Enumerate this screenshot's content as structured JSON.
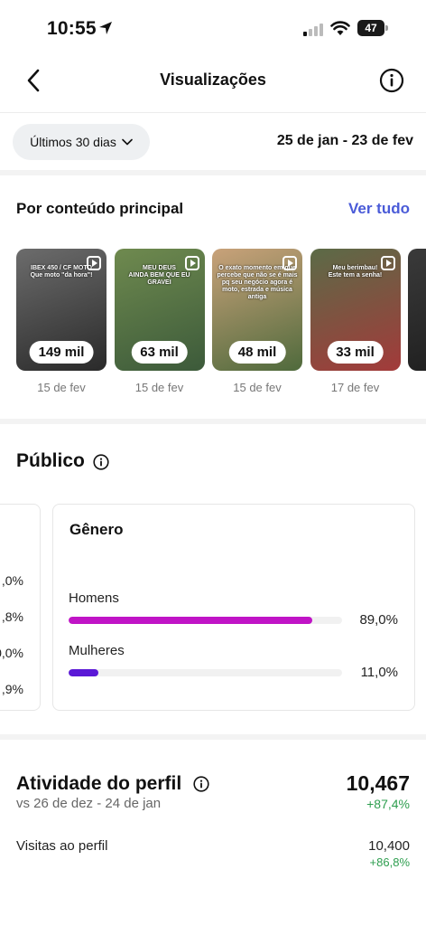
{
  "status_bar": {
    "time": "10:55",
    "battery": "47"
  },
  "header": {
    "title": "Visualizações",
    "back_icon": "chevron-left-icon",
    "info_icon": "info-icon"
  },
  "filter": {
    "period_label": "Últimos 30 dias",
    "date_range": "25 de jan - 23 de fev"
  },
  "top_content": {
    "title": "Por conteúdo principal",
    "see_all": "Ver tudo",
    "items": [
      {
        "caption": "IBEX 450 / CF MOTO\nQue moto \"da hora\"!",
        "views": "149 mil",
        "date": "15 de fev",
        "colors": [
          "#6c6c6c",
          "#2a2a2a"
        ]
      },
      {
        "caption": "MEU DEUS\nAINDA BEM QUE EU GRAVEI",
        "views": "63 mil",
        "date": "15 de fev",
        "colors": [
          "#6f8a4f",
          "#3c5a3a"
        ]
      },
      {
        "caption": "O exato momento em que percebe que não se é mais pq seu negócio agora é moto, estrada e música antiga",
        "views": "48 mil",
        "date": "15 de fev",
        "colors": [
          "#c9a27a",
          "#4f6a3c"
        ]
      },
      {
        "caption": "Meu berimbau!\nEste tem a senha!",
        "views": "33 mil",
        "date": "17 de fev",
        "colors": [
          "#5b6b47",
          "#a33a3a"
        ]
      }
    ]
  },
  "audience": {
    "title": "Público",
    "left_card_values": [
      ",0%",
      ",8%",
      "0,0%",
      ",9%"
    ],
    "gender": {
      "title": "Gênero",
      "rows": [
        {
          "label": "Homens",
          "percent_label": "89,0%",
          "value": 0.89,
          "color": "#c014c6"
        },
        {
          "label": "Mulheres",
          "percent_label": "11,0%",
          "value": 0.11,
          "color": "#5a18d6"
        }
      ]
    }
  },
  "profile_activity": {
    "title": "Atividade do perfil",
    "subtitle": "vs 26 de dez - 24 de jan",
    "total": "10,467",
    "change": "+87,4%",
    "visits_label": "Visitas ao perfil",
    "visits_value": "10,400",
    "visits_change": "+86,8%"
  },
  "colors": {
    "accent_link": "#4a5bd8",
    "positive": "#2e9e4f"
  }
}
